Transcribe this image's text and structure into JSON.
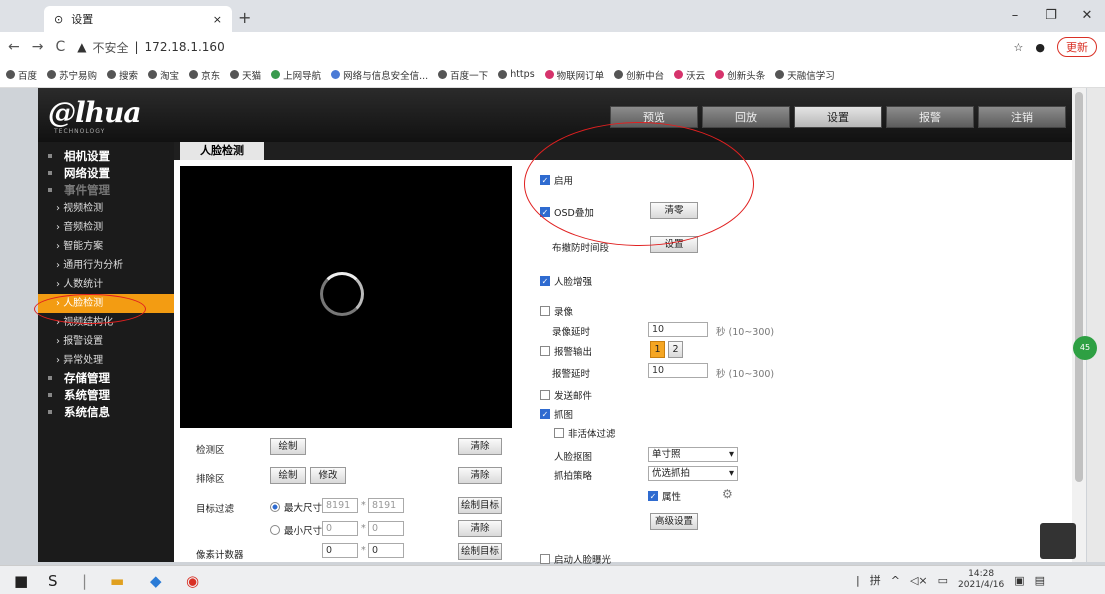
{
  "browser": {
    "tab_title": "设置",
    "url_warning": "不安全",
    "url": "172.18.1.160",
    "update_label": "更新",
    "bookmarks": [
      "百度",
      "苏宁易购",
      "搜索",
      "淘宝",
      "京东",
      "天猫",
      "上网导航",
      "网络与信息安全信...",
      "百度一下",
      "https",
      "物联网订单",
      "创新中台",
      "沃云",
      "创新头条",
      "天融信学习"
    ]
  },
  "app": {
    "logo": "alhua",
    "logo_sub": "TECHNOLOGY",
    "topnav": [
      "预览",
      "回放",
      "设置",
      "报警",
      "注销"
    ],
    "topnav_active": "设置",
    "sidebar": {
      "groups": [
        "相机设置",
        "网络设置",
        "事件管理",
        "存储管理",
        "系统管理",
        "系统信息"
      ],
      "items": [
        "视频检测",
        "音频检测",
        "智能方案",
        "通用行为分析",
        "人数统计",
        "人脸检测",
        "视频结构化",
        "报警设置",
        "异常处理"
      ],
      "active_item": "人脸检测"
    },
    "tab_label": "人脸检测"
  },
  "left_controls": {
    "detect_area": "检测区",
    "exclude_area": "排除区",
    "target_filter": "目标过滤",
    "pixel_counter": "像素计数器",
    "draw": "绘制",
    "modify": "修改",
    "clear": "清除",
    "draw_target": "绘制目标",
    "max_size": "最大尺寸",
    "min_size": "最小尺寸",
    "max_w": "8191",
    "max_h": "8191",
    "min_w": "0",
    "min_h": "0",
    "px_w": "0",
    "px_h": "0",
    "times": "*"
  },
  "right_controls": {
    "enable": "启用",
    "osd": "OSD叠加",
    "clear_zero": "清零",
    "schedule": "布撤防时间段",
    "setup": "设置",
    "face_enhance": "人脸增强",
    "record": "录像",
    "record_delay": "录像延时",
    "record_delay_val": "10",
    "record_delay_unit": "秒 (10~300)",
    "alarm_out": "报警输出",
    "alarm_ch1": "1",
    "alarm_ch2": "2",
    "alarm_delay": "报警延时",
    "alarm_delay_val": "10",
    "alarm_delay_unit": "秒 (10~300)",
    "send_email": "发送邮件",
    "snapshot": "抓图",
    "non_living": "非活体过滤",
    "face_image": "人脸抠图",
    "face_image_val": "单寸照",
    "snap_strategy": "抓拍策略",
    "snap_strategy_val": "优选抓拍",
    "attribute": "属性",
    "advanced": "高级设置",
    "face_exposure": "启动人脸曝光"
  },
  "taskbar": {
    "ime": "拼",
    "time": "14:28",
    "date": "2021/4/16",
    "float_badge": "45"
  }
}
